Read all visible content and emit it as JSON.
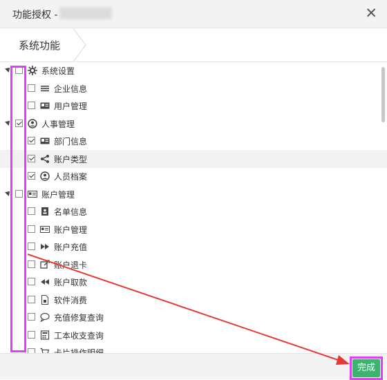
{
  "dialog": {
    "title": "功能授权 -",
    "close_glyph": "✕",
    "tab": "系统功能",
    "done_label": "完成",
    "accent_color": "#3cb371",
    "annotation_color": "#e040fb"
  },
  "tree": [
    {
      "label": "系统设置",
      "level": 0,
      "checked": false,
      "icon": "gear-icon",
      "expanded": true
    },
    {
      "label": "企业信息",
      "level": 1,
      "checked": false,
      "icon": "list-icon"
    },
    {
      "label": "用户管理",
      "level": 1,
      "checked": false,
      "icon": "id-card-icon"
    },
    {
      "label": "人事管理",
      "level": 0,
      "checked": true,
      "icon": "user-circle-icon",
      "expanded": true
    },
    {
      "label": "部门信息",
      "level": 1,
      "checked": true,
      "icon": "id-card-icon"
    },
    {
      "label": "账户类型",
      "level": 1,
      "checked": true,
      "icon": "share-icon",
      "highlighted": true
    },
    {
      "label": "人员档案",
      "level": 1,
      "checked": true,
      "icon": "user-circle-icon"
    },
    {
      "label": "账户管理",
      "level": 0,
      "checked": false,
      "icon": "card-outline-icon",
      "expanded": true
    },
    {
      "label": "名单信息",
      "level": 1,
      "checked": false,
      "icon": "contact-book-icon"
    },
    {
      "label": "账户管理",
      "level": 1,
      "checked": false,
      "icon": "card-outline-icon"
    },
    {
      "label": "账户充值",
      "level": 1,
      "checked": false,
      "icon": "fast-forward-icon"
    },
    {
      "label": "账户退卡",
      "level": 1,
      "checked": false,
      "icon": "export-icon"
    },
    {
      "label": "账户取款",
      "level": 1,
      "checked": false,
      "icon": "rewind-icon"
    },
    {
      "label": "软件消费",
      "level": 1,
      "checked": false,
      "icon": "document-icon"
    },
    {
      "label": "充值修复查询",
      "level": 1,
      "checked": false,
      "icon": "chat-bubble-icon"
    },
    {
      "label": "工本收支查询",
      "level": 1,
      "checked": false,
      "icon": "calculator-icon"
    },
    {
      "label": "卡片操作明细",
      "level": 1,
      "checked": false,
      "icon": "cart-icon"
    }
  ]
}
